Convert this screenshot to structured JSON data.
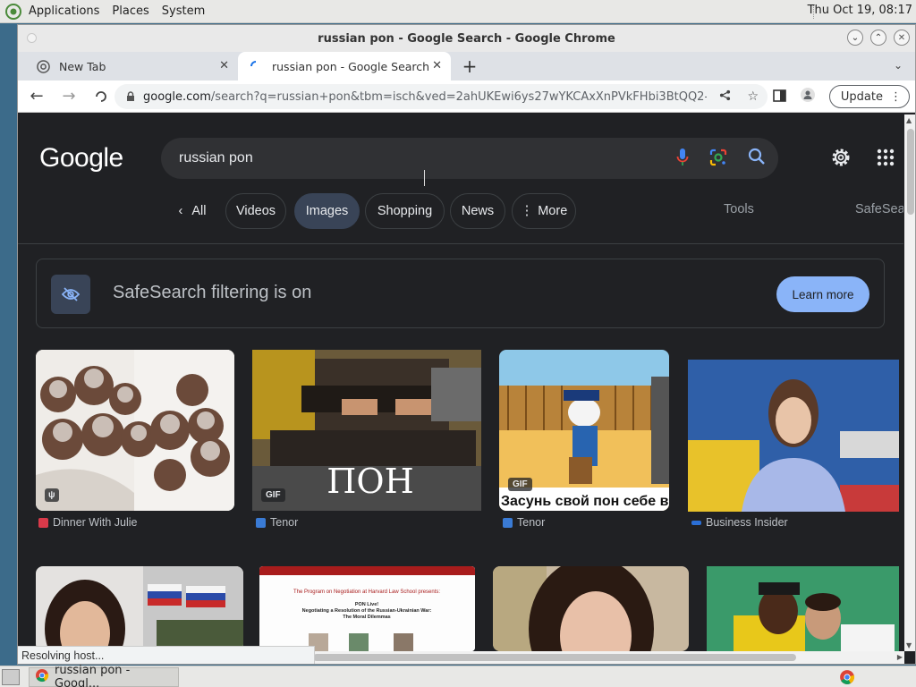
{
  "desktop": {
    "menus": [
      "Applications",
      "Places",
      "System"
    ],
    "clock": "Thu Oct 19, 08:17"
  },
  "window": {
    "title": "russian pon - Google Search - Google Chrome"
  },
  "tabs": [
    {
      "label": "New Tab"
    },
    {
      "label": "russian pon - Google Search"
    }
  ],
  "toolbar": {
    "url_host": "google.com",
    "url_path": "/search?q=russian+pon&tbm=isch&ved=2ahUKEwi6ys27wYKCAxXnPVkFHbi3BtQQ2-cC...",
    "update_label": "Update"
  },
  "google": {
    "logo": "Google",
    "query": "russian pon",
    "chips": [
      "All",
      "Videos",
      "Images",
      "Shopping",
      "News",
      "More"
    ],
    "tools": "Tools",
    "safesearch_cut": "SafeSear"
  },
  "safesearch": {
    "text": "SafeSearch filtering is on",
    "learn_more": "Learn more"
  },
  "results": [
    {
      "source": "Dinner With Julie",
      "badge": ""
    },
    {
      "source": "Tenor",
      "badge": "GIF",
      "overlay": "ПОН"
    },
    {
      "source": "Tenor",
      "badge": "GIF",
      "overlay": "Засунь свой пон себе в"
    },
    {
      "source": "Business Insider",
      "badge": ""
    }
  ],
  "second_row_text": {
    "line1": "The Program on Negotiation at Harvard Law School presents:",
    "line2": "PON Live!",
    "line3": "Negotiating a Resolution of the Russian-Ukrainian War:",
    "line4": "The Moral Dilemmas"
  },
  "status": "Resolving host...",
  "taskbar": {
    "task_label": "russian pon - Googl..."
  },
  "colors": {
    "page_bg": "#202124",
    "chip_selected": "#394457",
    "learn_more": "#8ab4f8"
  }
}
